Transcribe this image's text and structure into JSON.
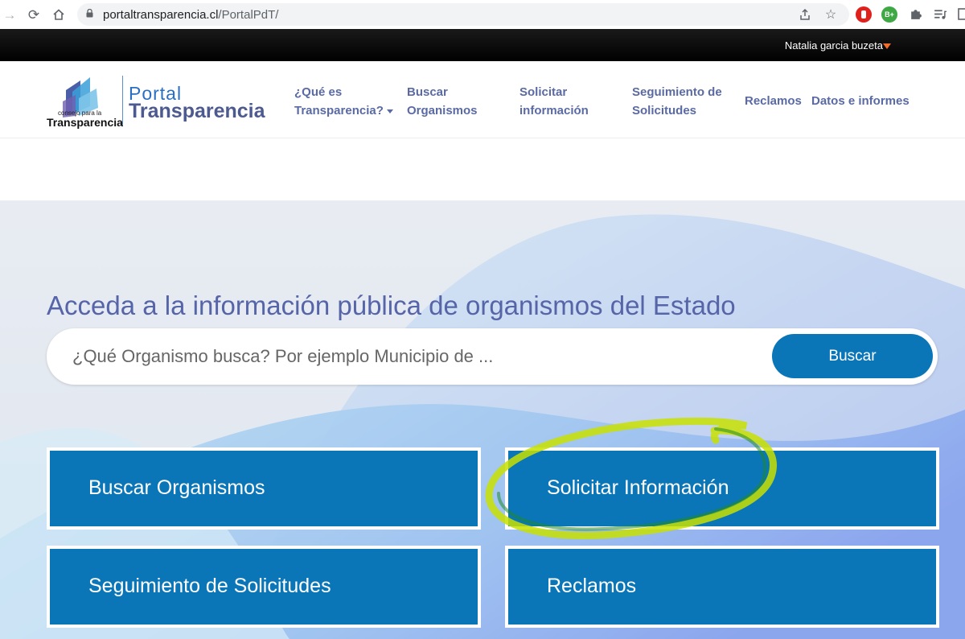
{
  "browser": {
    "url_host": "portaltransparencia.cl",
    "url_path": "/PortalPdT/",
    "extension_badge": "B+"
  },
  "userbar": {
    "user_name": "Natalia garcia buzeta"
  },
  "logo": {
    "small_text": "consejo para la",
    "big_text": "Transparencia",
    "portal_word": "Portal",
    "transparencia_word": "Transparencia"
  },
  "menu": {
    "que_es_line1": "¿Qué es",
    "que_es_line2": "Transparencia?",
    "buscar_line1": "Buscar",
    "buscar_line2": "Organismos",
    "solicitar_line1": "Solicitar",
    "solicitar_line2": "información",
    "seguimiento_line1": "Seguimiento de",
    "seguimiento_line2": "Solicitudes",
    "reclamos": "Reclamos",
    "datos": "Datos e informes"
  },
  "hero": {
    "title": "Acceda a la información pública de organismos del Estado",
    "search_placeholder": "¿Qué Organismo busca? Por ejemplo Municipio de ...",
    "search_button": "Buscar"
  },
  "tiles": {
    "buscar": "Buscar Organismos",
    "solicitar": "Solicitar Información",
    "seguimiento": "Seguimiento de Solicitudes",
    "reclamos": "Reclamos"
  },
  "colors": {
    "accent_blue": "#0a76b8",
    "menu_text": "#5a6aa3",
    "highlight": "#c8e000",
    "user_caret": "#f26c2b"
  }
}
